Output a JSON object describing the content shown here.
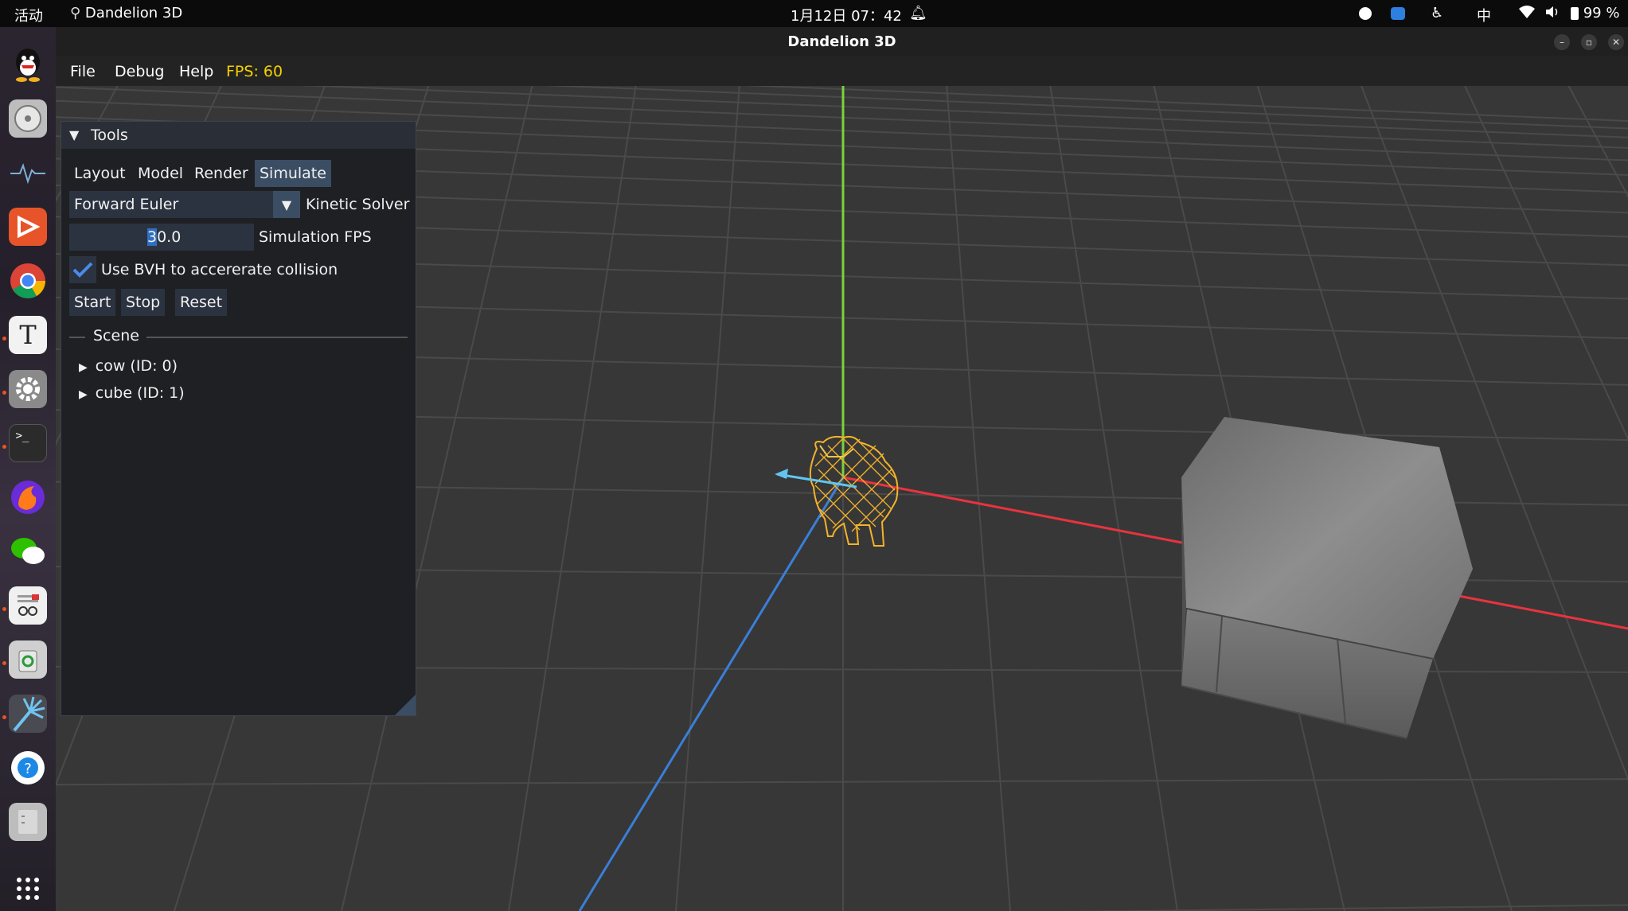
{
  "topbar": {
    "activities": "活动",
    "app_name": "Dandelion 3D",
    "datetime": "1月12日  07：42",
    "input_method": "中",
    "battery": "99 %"
  },
  "dock": {
    "items": [
      {
        "name": "qq-icon",
        "color": "#111111"
      },
      {
        "name": "disk-utility-icon",
        "color": "#cfcfcf"
      },
      {
        "name": "system-monitor-icon",
        "color": "#2e2e2e"
      },
      {
        "name": "presentation-app-icon",
        "color": "#e8542a"
      },
      {
        "name": "chrome-icon",
        "color": "#ffffff"
      },
      {
        "name": "text-editor-icon",
        "color": "#f2f2f2"
      },
      {
        "name": "settings-icon",
        "color": "#8c8c8c"
      },
      {
        "name": "terminal-icon",
        "color": "#2b2b2b"
      },
      {
        "name": "firefox-dev-icon",
        "color": "#8a2be2"
      },
      {
        "name": "wechat-icon",
        "color": "#ffffff"
      },
      {
        "name": "document-viewer-icon",
        "color": "#f0f0f0"
      },
      {
        "name": "trash-icon",
        "color": "#cfcfcf"
      },
      {
        "name": "dandelion-icon",
        "color": "#4aa8d8"
      },
      {
        "name": "help-icon",
        "color": "#ffffff"
      },
      {
        "name": "file-manager-icon",
        "color": "#bdbdbd"
      },
      {
        "name": "show-apps-icon",
        "color": "#ffffff"
      }
    ]
  },
  "window": {
    "title": "Dandelion 3D"
  },
  "menubar": {
    "file": "File",
    "debug": "Debug",
    "help": "Help",
    "fps": "FPS: 60",
    "fps_color": "#f5d000"
  },
  "tools_panel": {
    "title": "Tools",
    "tabs": [
      "Layout",
      "Model",
      "Render",
      "Simulate"
    ],
    "active_tab": "Simulate",
    "solver_value": "Forward Euler",
    "solver_label": "Kinetic Solver",
    "fps_value": "30.0",
    "fps_label": "Simulation FPS",
    "bvh_label": "Use BVH to accererate collision",
    "bvh_checked": true,
    "start": "Start",
    "stop": "Stop",
    "reset": "Reset",
    "scene_header": "Scene",
    "scene_items": [
      "cow (ID: 0)",
      "cube (ID: 1)"
    ]
  },
  "colors": {
    "accent_blue": "#3b4d63",
    "axis_x": "#e8333f",
    "axis_y": "#7bd23a",
    "axis_z": "#3a7fd8",
    "cow": "#f5b32a"
  }
}
